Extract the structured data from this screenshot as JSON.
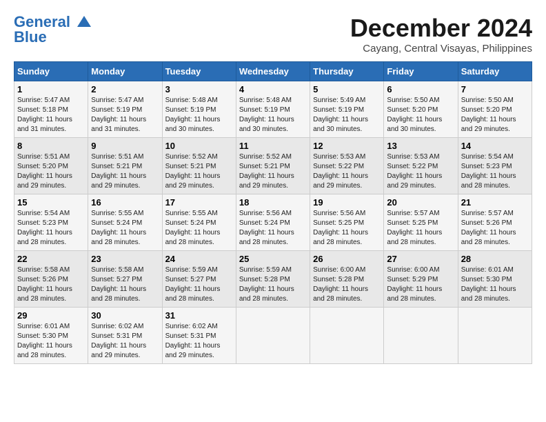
{
  "logo": {
    "line1": "General",
    "line2": "Blue"
  },
  "title": "December 2024",
  "location": "Cayang, Central Visayas, Philippines",
  "days_of_week": [
    "Sunday",
    "Monday",
    "Tuesday",
    "Wednesday",
    "Thursday",
    "Friday",
    "Saturday"
  ],
  "weeks": [
    [
      {
        "day": "1",
        "info": "Sunrise: 5:47 AM\nSunset: 5:18 PM\nDaylight: 11 hours\nand 31 minutes."
      },
      {
        "day": "2",
        "info": "Sunrise: 5:47 AM\nSunset: 5:19 PM\nDaylight: 11 hours\nand 31 minutes."
      },
      {
        "day": "3",
        "info": "Sunrise: 5:48 AM\nSunset: 5:19 PM\nDaylight: 11 hours\nand 30 minutes."
      },
      {
        "day": "4",
        "info": "Sunrise: 5:48 AM\nSunset: 5:19 PM\nDaylight: 11 hours\nand 30 minutes."
      },
      {
        "day": "5",
        "info": "Sunrise: 5:49 AM\nSunset: 5:19 PM\nDaylight: 11 hours\nand 30 minutes."
      },
      {
        "day": "6",
        "info": "Sunrise: 5:50 AM\nSunset: 5:20 PM\nDaylight: 11 hours\nand 30 minutes."
      },
      {
        "day": "7",
        "info": "Sunrise: 5:50 AM\nSunset: 5:20 PM\nDaylight: 11 hours\nand 29 minutes."
      }
    ],
    [
      {
        "day": "8",
        "info": "Sunrise: 5:51 AM\nSunset: 5:20 PM\nDaylight: 11 hours\nand 29 minutes."
      },
      {
        "day": "9",
        "info": "Sunrise: 5:51 AM\nSunset: 5:21 PM\nDaylight: 11 hours\nand 29 minutes."
      },
      {
        "day": "10",
        "info": "Sunrise: 5:52 AM\nSunset: 5:21 PM\nDaylight: 11 hours\nand 29 minutes."
      },
      {
        "day": "11",
        "info": "Sunrise: 5:52 AM\nSunset: 5:21 PM\nDaylight: 11 hours\nand 29 minutes."
      },
      {
        "day": "12",
        "info": "Sunrise: 5:53 AM\nSunset: 5:22 PM\nDaylight: 11 hours\nand 29 minutes."
      },
      {
        "day": "13",
        "info": "Sunrise: 5:53 AM\nSunset: 5:22 PM\nDaylight: 11 hours\nand 29 minutes."
      },
      {
        "day": "14",
        "info": "Sunrise: 5:54 AM\nSunset: 5:23 PM\nDaylight: 11 hours\nand 28 minutes."
      }
    ],
    [
      {
        "day": "15",
        "info": "Sunrise: 5:54 AM\nSunset: 5:23 PM\nDaylight: 11 hours\nand 28 minutes."
      },
      {
        "day": "16",
        "info": "Sunrise: 5:55 AM\nSunset: 5:24 PM\nDaylight: 11 hours\nand 28 minutes."
      },
      {
        "day": "17",
        "info": "Sunrise: 5:55 AM\nSunset: 5:24 PM\nDaylight: 11 hours\nand 28 minutes."
      },
      {
        "day": "18",
        "info": "Sunrise: 5:56 AM\nSunset: 5:24 PM\nDaylight: 11 hours\nand 28 minutes."
      },
      {
        "day": "19",
        "info": "Sunrise: 5:56 AM\nSunset: 5:25 PM\nDaylight: 11 hours\nand 28 minutes."
      },
      {
        "day": "20",
        "info": "Sunrise: 5:57 AM\nSunset: 5:25 PM\nDaylight: 11 hours\nand 28 minutes."
      },
      {
        "day": "21",
        "info": "Sunrise: 5:57 AM\nSunset: 5:26 PM\nDaylight: 11 hours\nand 28 minutes."
      }
    ],
    [
      {
        "day": "22",
        "info": "Sunrise: 5:58 AM\nSunset: 5:26 PM\nDaylight: 11 hours\nand 28 minutes."
      },
      {
        "day": "23",
        "info": "Sunrise: 5:58 AM\nSunset: 5:27 PM\nDaylight: 11 hours\nand 28 minutes."
      },
      {
        "day": "24",
        "info": "Sunrise: 5:59 AM\nSunset: 5:27 PM\nDaylight: 11 hours\nand 28 minutes."
      },
      {
        "day": "25",
        "info": "Sunrise: 5:59 AM\nSunset: 5:28 PM\nDaylight: 11 hours\nand 28 minutes."
      },
      {
        "day": "26",
        "info": "Sunrise: 6:00 AM\nSunset: 5:28 PM\nDaylight: 11 hours\nand 28 minutes."
      },
      {
        "day": "27",
        "info": "Sunrise: 6:00 AM\nSunset: 5:29 PM\nDaylight: 11 hours\nand 28 minutes."
      },
      {
        "day": "28",
        "info": "Sunrise: 6:01 AM\nSunset: 5:30 PM\nDaylight: 11 hours\nand 28 minutes."
      }
    ],
    [
      {
        "day": "29",
        "info": "Sunrise: 6:01 AM\nSunset: 5:30 PM\nDaylight: 11 hours\nand 28 minutes."
      },
      {
        "day": "30",
        "info": "Sunrise: 6:02 AM\nSunset: 5:31 PM\nDaylight: 11 hours\nand 29 minutes."
      },
      {
        "day": "31",
        "info": "Sunrise: 6:02 AM\nSunset: 5:31 PM\nDaylight: 11 hours\nand 29 minutes."
      },
      {
        "day": "",
        "info": ""
      },
      {
        "day": "",
        "info": ""
      },
      {
        "day": "",
        "info": ""
      },
      {
        "day": "",
        "info": ""
      }
    ]
  ]
}
